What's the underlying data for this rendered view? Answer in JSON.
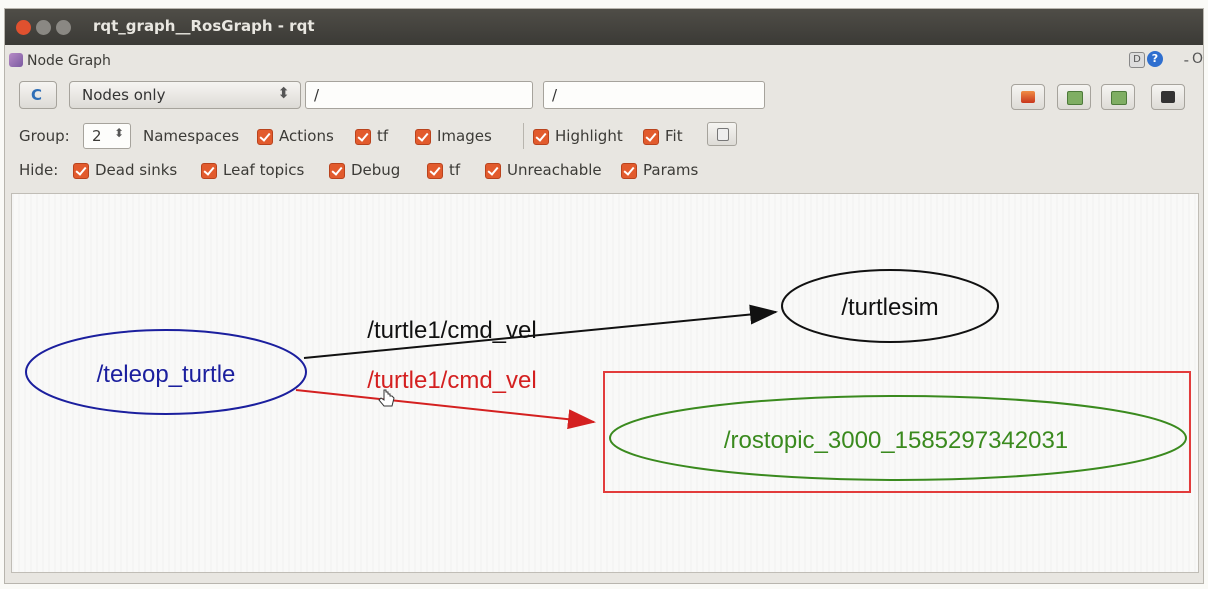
{
  "window": {
    "title": "rqt_graph__RosGraph - rqt"
  },
  "plugin": {
    "title": "Node Graph",
    "help_d": "D",
    "help_q": "?",
    "minus": "-",
    "o": "O"
  },
  "toolbar": {
    "refresh_icon": "refresh-icon",
    "mode": "Nodes only",
    "node_filter": "/",
    "topic_filter": "/",
    "load_icon": "load-icon",
    "save_dot_icon": "save-dot-icon",
    "save_svg_icon": "save-svg-icon",
    "save_image_icon": "save-image-icon"
  },
  "group_row": {
    "group_label": "Group:",
    "group_value": "2",
    "namespaces": "Namespaces",
    "actions": "Actions",
    "tf": "tf",
    "images": "Images",
    "highlight": "Highlight",
    "fit": "Fit"
  },
  "hide_row": {
    "hide_label": "Hide:",
    "dead_sinks": "Dead sinks",
    "leaf_topics": "Leaf topics",
    "debug": "Debug",
    "tf": "tf",
    "unreachable": "Unreachable",
    "params": "Params"
  },
  "graph": {
    "nodes": {
      "teleop": "/teleop_turtle",
      "turtlesim": "/turtlesim",
      "rostopic": "/rostopic_3000_1585297342031"
    },
    "edges": {
      "cmd_vel_black": "/turtle1/cmd_vel",
      "cmd_vel_red": "/turtle1/cmd_vel"
    },
    "colors": {
      "teleop": "#1b1f9e",
      "turtlesim": "#111111",
      "rostopic": "#3a8a1e",
      "highlight_edge": "#d42020",
      "selection_box": "#e23b3b"
    }
  }
}
